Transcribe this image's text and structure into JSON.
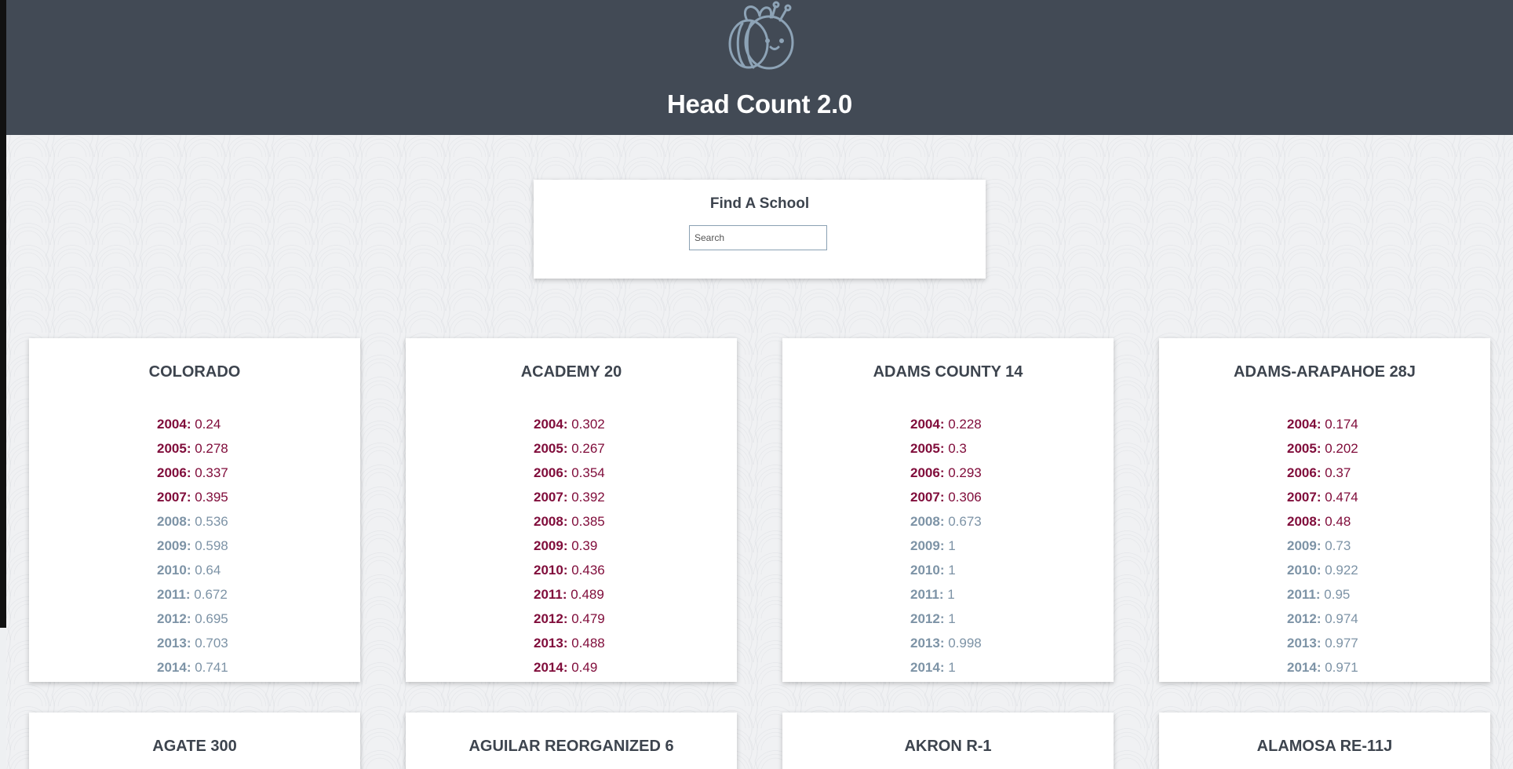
{
  "header": {
    "title": "Head Count 2.0",
    "logo_icon": "bee-logo-icon",
    "background_color": "#424a55"
  },
  "search": {
    "title": "Find A School",
    "placeholder": "Search",
    "value": ""
  },
  "colors": {
    "below_threshold": "#800d3b",
    "above_threshold": "#7d93a6"
  },
  "districts": [
    {
      "name": "COLORADO",
      "rows": [
        {
          "year": "2004:",
          "value": "0.24",
          "status": "low"
        },
        {
          "year": "2005:",
          "value": "0.278",
          "status": "low"
        },
        {
          "year": "2006:",
          "value": "0.337",
          "status": "low"
        },
        {
          "year": "2007:",
          "value": "0.395",
          "status": "low"
        },
        {
          "year": "2008:",
          "value": "0.536",
          "status": "high"
        },
        {
          "year": "2009:",
          "value": "0.598",
          "status": "high"
        },
        {
          "year": "2010:",
          "value": "0.64",
          "status": "high"
        },
        {
          "year": "2011:",
          "value": "0.672",
          "status": "high"
        },
        {
          "year": "2012:",
          "value": "0.695",
          "status": "high"
        },
        {
          "year": "2013:",
          "value": "0.703",
          "status": "high"
        },
        {
          "year": "2014:",
          "value": "0.741",
          "status": "high"
        }
      ]
    },
    {
      "name": "ACADEMY 20",
      "rows": [
        {
          "year": "2004:",
          "value": "0.302",
          "status": "low"
        },
        {
          "year": "2005:",
          "value": "0.267",
          "status": "low"
        },
        {
          "year": "2006:",
          "value": "0.354",
          "status": "low"
        },
        {
          "year": "2007:",
          "value": "0.392",
          "status": "low"
        },
        {
          "year": "2008:",
          "value": "0.385",
          "status": "low"
        },
        {
          "year": "2009:",
          "value": "0.39",
          "status": "low"
        },
        {
          "year": "2010:",
          "value": "0.436",
          "status": "low"
        },
        {
          "year": "2011:",
          "value": "0.489",
          "status": "low"
        },
        {
          "year": "2012:",
          "value": "0.479",
          "status": "low"
        },
        {
          "year": "2013:",
          "value": "0.488",
          "status": "low"
        },
        {
          "year": "2014:",
          "value": "0.49",
          "status": "low"
        }
      ]
    },
    {
      "name": "ADAMS COUNTY 14",
      "rows": [
        {
          "year": "2004:",
          "value": "0.228",
          "status": "low"
        },
        {
          "year": "2005:",
          "value": "0.3",
          "status": "low"
        },
        {
          "year": "2006:",
          "value": "0.293",
          "status": "low"
        },
        {
          "year": "2007:",
          "value": "0.306",
          "status": "low"
        },
        {
          "year": "2008:",
          "value": "0.673",
          "status": "high"
        },
        {
          "year": "2009:",
          "value": "1",
          "status": "high"
        },
        {
          "year": "2010:",
          "value": "1",
          "status": "high"
        },
        {
          "year": "2011:",
          "value": "1",
          "status": "high"
        },
        {
          "year": "2012:",
          "value": "1",
          "status": "high"
        },
        {
          "year": "2013:",
          "value": "0.998",
          "status": "high"
        },
        {
          "year": "2014:",
          "value": "1",
          "status": "high"
        }
      ]
    },
    {
      "name": "ADAMS-ARAPAHOE 28J",
      "rows": [
        {
          "year": "2004:",
          "value": "0.174",
          "status": "low"
        },
        {
          "year": "2005:",
          "value": "0.202",
          "status": "low"
        },
        {
          "year": "2006:",
          "value": "0.37",
          "status": "low"
        },
        {
          "year": "2007:",
          "value": "0.474",
          "status": "low"
        },
        {
          "year": "2008:",
          "value": "0.48",
          "status": "low"
        },
        {
          "year": "2009:",
          "value": "0.73",
          "status": "high"
        },
        {
          "year": "2010:",
          "value": "0.922",
          "status": "high"
        },
        {
          "year": "2011:",
          "value": "0.95",
          "status": "high"
        },
        {
          "year": "2012:",
          "value": "0.974",
          "status": "high"
        },
        {
          "year": "2013:",
          "value": "0.977",
          "status": "high"
        },
        {
          "year": "2014:",
          "value": "0.971",
          "status": "high"
        }
      ]
    },
    {
      "name": "AGATE 300",
      "rows": []
    },
    {
      "name": "AGUILAR REORGANIZED 6",
      "rows": []
    },
    {
      "name": "AKRON R-1",
      "rows": []
    },
    {
      "name": "ALAMOSA RE-11J",
      "rows": []
    }
  ]
}
